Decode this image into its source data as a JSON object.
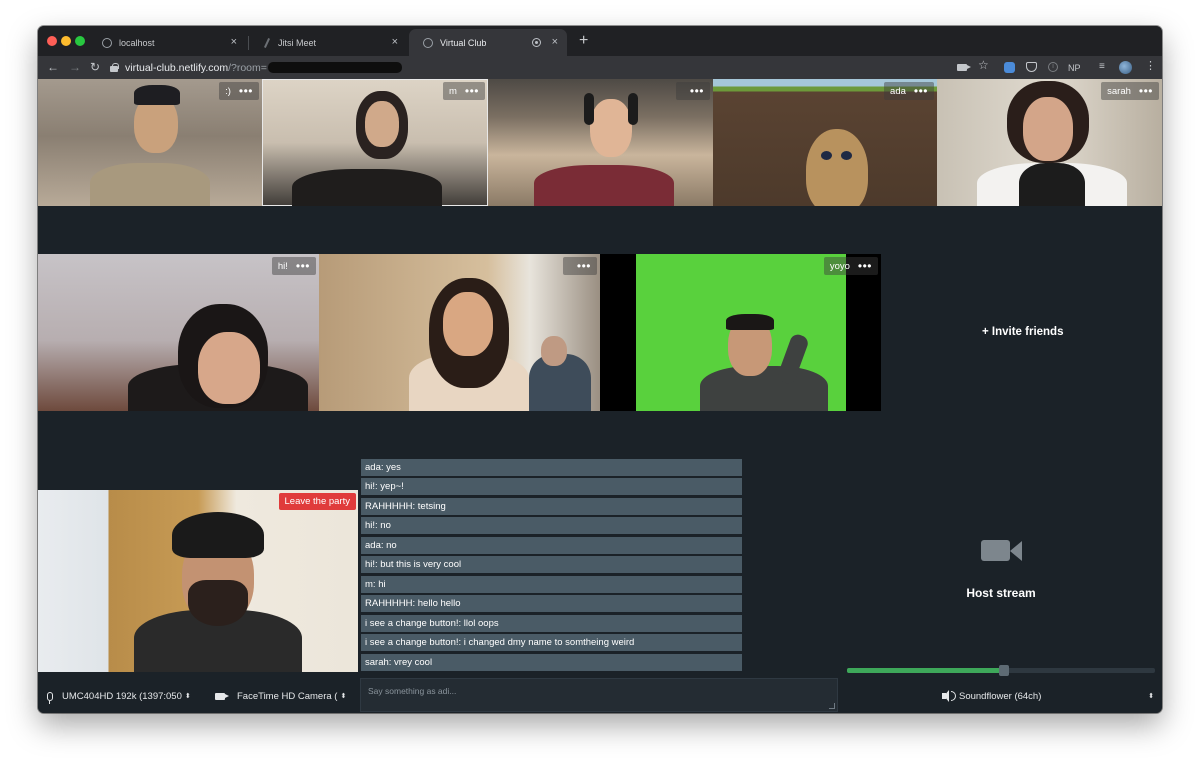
{
  "browser": {
    "tabs": [
      {
        "title": "localhost",
        "icon": "globe-icon",
        "active": false
      },
      {
        "title": "Jitsi Meet",
        "icon": "feather-icon",
        "active": false
      },
      {
        "title": "Virtual Club",
        "icon": "globe-icon",
        "active": true
      }
    ],
    "close_glyph": "×",
    "new_tab_glyph": "+",
    "url_host": "virtual-club.netlify.com",
    "url_path": "/?room=",
    "np_label": "NP"
  },
  "participants_row1": [
    {
      "name": ":)"
    },
    {
      "name": "m"
    },
    {
      "name": ""
    },
    {
      "name": "ada"
    },
    {
      "name": "sarah"
    }
  ],
  "participants_row2": [
    {
      "name": "hi!"
    },
    {
      "name": ""
    },
    {
      "name": "yoyo"
    }
  ],
  "more_glyph": "•••",
  "invite_label": "+ Invite friends",
  "self_view": {
    "leave_label": "Leave the party"
  },
  "devices": {
    "microphone": "UMC404HD 192k (1397:050",
    "camera": "FaceTime HD Camera (",
    "audio_output": "Soundflower (64ch)",
    "updown_glyph": "⬍"
  },
  "chat": {
    "messages": [
      "ada: yes",
      "hi!: yep~!",
      "RAHHHHH: tetsing",
      "hi!: no",
      "ada: no",
      "hi!: but this is very cool",
      "m: hi",
      "RAHHHHH: hello hello",
      "i see a change button!: llol oops",
      "i see a change button!: i changed dmy name to somtheing weird",
      "sarah: vrey cool"
    ],
    "placeholder": "Say something as adi..."
  },
  "host": {
    "label": "Host stream",
    "volume_fraction": 0.51
  },
  "colors": {
    "app_bg": "#1b2228",
    "leave_button": "#e03b3b",
    "chat_bubble": "#4a5b66",
    "volume_fill": "#3ea85a",
    "green_screen": "#59d13d"
  }
}
